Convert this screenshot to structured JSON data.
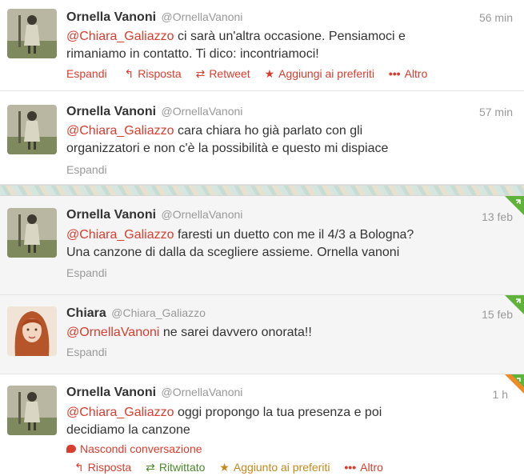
{
  "tweets": [
    {
      "name": "Ornella Vanoni",
      "handle": "@OrnellaVanoni",
      "time": "56 min",
      "mention": "@Chiara_Galiazzo",
      "line1_rest": " ci sarà un'altra occasione. Pensiamoci e",
      "line2": "rimaniamo in contatto. Ti dico: incontriamoci!",
      "actions": {
        "expand": "Espandi",
        "reply": "Risposta",
        "retweet": "Retweet",
        "favorite": "Aggiungi ai preferiti",
        "more": "Altro"
      }
    },
    {
      "name": "Ornella Vanoni",
      "handle": "@OrnellaVanoni",
      "time": "57 min",
      "mention": "@Chiara_Galiazzo",
      "line1_rest": " cara chiara ho già parlato con gli",
      "line2": "organizzatori e non c'è la possibilità e questo mi dispiace",
      "expand": "Espandi"
    },
    {
      "name": "Ornella Vanoni",
      "handle": "@OrnellaVanoni",
      "time": "13 feb",
      "mention": "@Chiara_Galiazzo",
      "line1_rest": " faresti un duetto con me il 4/3 a Bologna?",
      "line2": "Una canzone di dalla da scegliere assieme. Ornella vanoni",
      "expand": "Espandi"
    },
    {
      "name": "Chiara",
      "handle": "@Chiara_Galiazzo",
      "time": "15 feb",
      "mention": "@OrnellaVanoni",
      "line1_rest": " ne sarei davvero onorata!!",
      "expand": "Espandi"
    },
    {
      "name": "Ornella Vanoni",
      "handle": "@OrnellaVanoni",
      "time": "1 h",
      "mention": "@Chiara_Galiazzo",
      "line1_rest": " oggi propongo la tua presenza e poi",
      "line2": "decidiamo la canzone",
      "hide_conversation": "Nascondi conversazione",
      "actions": {
        "reply": "Risposta",
        "retweeted": "Ritwittato",
        "favorited": "Aggiunto ai preferiti",
        "more": "Altro"
      }
    }
  ],
  "colors": {
    "mention": "#d83d2e",
    "retweet_green": "#4a8a2a",
    "favorite_orange": "#c4891a",
    "corner_green": "#5fb23a",
    "corner_orange": "#f08a24"
  },
  "icons": [
    "reply-icon",
    "retweet-icon",
    "star-icon",
    "more-icon",
    "speech-bubble-icon"
  ]
}
